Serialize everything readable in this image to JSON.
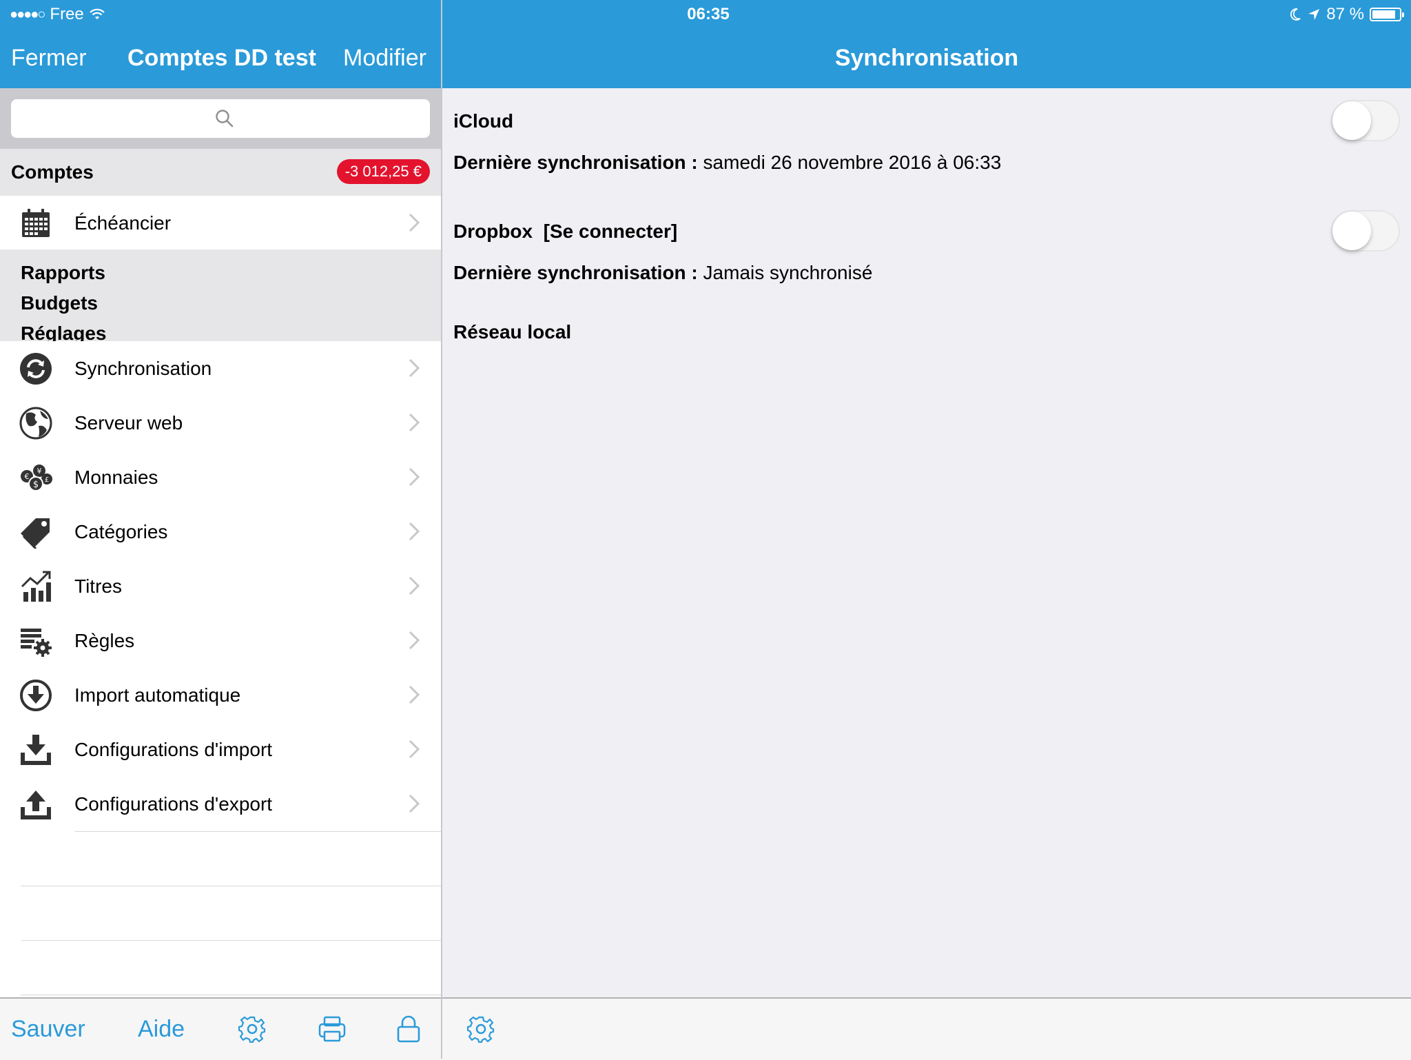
{
  "status_bar": {
    "signal": "●●●●○",
    "carrier": "Free",
    "time": "06:35",
    "battery_text": "87 %",
    "battery_level": 0.87
  },
  "master": {
    "close_label": "Fermer",
    "title": "Comptes DD test",
    "edit_label": "Modifier",
    "accounts_label": "Comptes",
    "accounts_balance": "-3 012,25 €",
    "schedule_label": "Échéancier",
    "sections": [
      "Rapports",
      "Budgets",
      "Réglages"
    ],
    "settings_items": [
      {
        "label": "Synchronisation",
        "icon": "sync-icon"
      },
      {
        "label": "Serveur web",
        "icon": "globe-icon"
      },
      {
        "label": "Monnaies",
        "icon": "currencies-icon"
      },
      {
        "label": "Catégories",
        "icon": "tags-icon"
      },
      {
        "label": "Titres",
        "icon": "chart-up-icon"
      },
      {
        "label": "Règles",
        "icon": "rules-gear-icon"
      },
      {
        "label": "Import automatique",
        "icon": "download-circle-icon"
      },
      {
        "label": "Configurations d'import",
        "icon": "tray-download-icon"
      },
      {
        "label": "Configurations d'export",
        "icon": "tray-upload-icon"
      }
    ],
    "toolbar": {
      "save_label": "Sauver",
      "help_label": "Aide"
    }
  },
  "detail": {
    "title": "Synchronisation",
    "icloud": {
      "label": "iCloud",
      "enabled": false,
      "last_sync_label": "Dernière synchronisation :",
      "last_sync_value": "samedi 26 novembre 2016 à 06:33"
    },
    "dropbox": {
      "label": "Dropbox",
      "connect_label": "[Se connecter]",
      "enabled": false,
      "last_sync_label": "Dernière synchronisation :",
      "last_sync_value": "Jamais synchronisé"
    },
    "local_network_label": "Réseau local"
  },
  "colors": {
    "accent": "#2a9ad9",
    "badge": "#e3132e"
  }
}
